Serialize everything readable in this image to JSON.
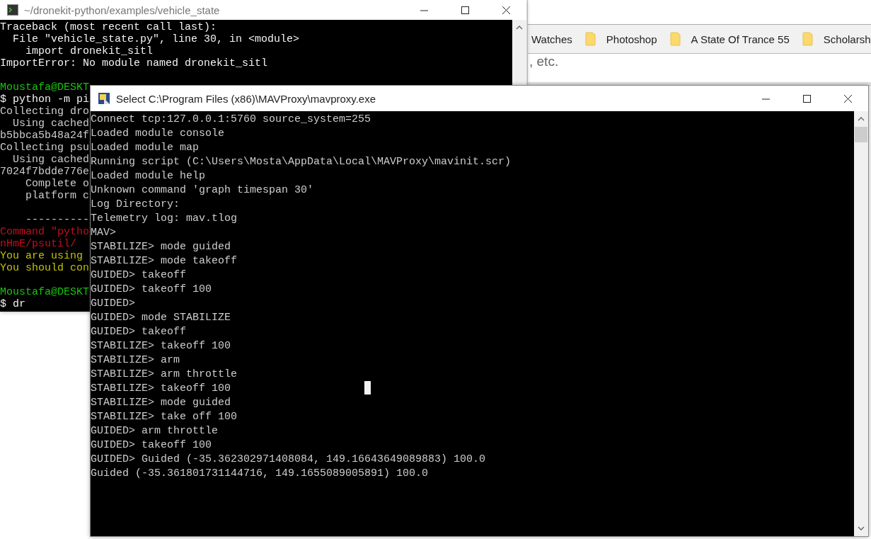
{
  "browser": {
    "bookmarks": [
      {
        "label": "Watches",
        "folder_icon": false
      },
      {
        "label": "Photoshop",
        "folder_icon": true
      },
      {
        "label": "A State Of Trance 55",
        "folder_icon": true
      },
      {
        "label": "Scholarsh",
        "folder_icon": true
      }
    ],
    "page_text": ", etc."
  },
  "back_terminal": {
    "title": "~/dronekit-python/examples/vehicle_state",
    "lines": [
      {
        "kind": "text",
        "text": "Traceback (most recent call last):",
        "color": "#f2f2f2"
      },
      {
        "kind": "text",
        "text": "  File \"vehicle_state.py\", line 30, in <module>",
        "color": "#f2f2f2"
      },
      {
        "kind": "text",
        "text": "    import dronekit_sitl",
        "color": "#f2f2f2"
      },
      {
        "kind": "text",
        "text": "ImportError: No module named dronekit_sitl",
        "color": "#f2f2f2"
      },
      {
        "kind": "blank"
      },
      {
        "kind": "text",
        "text": "Moustafa@DESKT",
        "color": "#16c60c"
      },
      {
        "kind": "text",
        "text": "$ python -m pi",
        "color": "#f2f2f2"
      },
      {
        "kind": "text",
        "text": "Collecting dro",
        "color": "#cccccc"
      },
      {
        "kind": "text",
        "text": "  Using cached",
        "color": "#cccccc"
      },
      {
        "kind": "text",
        "text": "b5bbca5b48a24f",
        "color": "#cccccc"
      },
      {
        "kind": "text",
        "text": "Collecting psu",
        "color": "#cccccc"
      },
      {
        "kind": "text",
        "text": "  Using cached",
        "color": "#cccccc"
      },
      {
        "kind": "text",
        "text": "7024f7bdde776e",
        "color": "#cccccc"
      },
      {
        "kind": "text",
        "text": "    Complete o",
        "color": "#cccccc"
      },
      {
        "kind": "text",
        "text": "    platform c",
        "color": "#cccccc"
      },
      {
        "kind": "blank"
      },
      {
        "kind": "text",
        "text": "    ----------",
        "color": "#cccccc"
      },
      {
        "kind": "text",
        "text": "Command \"pytho",
        "color": "#c50f1f"
      },
      {
        "kind": "text",
        "text": "nHmE/psutil/",
        "color": "#c50f1f"
      },
      {
        "kind": "text",
        "text": "You are using",
        "color": "#c1c100"
      },
      {
        "kind": "text",
        "text": "You should con",
        "color": "#c1c100"
      },
      {
        "kind": "blank"
      },
      {
        "kind": "text",
        "text": "Moustafa@DESKT",
        "color": "#16c60c"
      },
      {
        "kind": "text",
        "text": "$ dr",
        "color": "#f2f2f2"
      }
    ]
  },
  "front_terminal": {
    "title": "Select C:\\Program Files (x86)\\MAVProxy\\mavproxy.exe",
    "lines": [
      "Connect tcp:127.0.0.1:5760 source_system=255",
      "Loaded module console",
      "Loaded module map",
      "Running script (C:\\Users\\Mosta\\AppData\\Local\\MAVProxy\\mavinit.scr)",
      "Loaded module help",
      "Unknown command 'graph timespan 30'",
      "Log Directory:",
      "Telemetry log: mav.tlog",
      "MAV>",
      "STABILIZE> mode guided",
      "STABILIZE> mode takeoff",
      "GUIDED> takeoff",
      "GUIDED> takeoff 100",
      "GUIDED>",
      "GUIDED> mode STABILIZE",
      "GUIDED> takeoff",
      "STABILIZE> takeoff 100",
      "STABILIZE> arm",
      "STABILIZE> arm throttle",
      "STABILIZE> takeoff 100",
      "STABILIZE> mode guided",
      "STABILIZE> take off 100",
      "GUIDED> arm throttle",
      "GUIDED> takeoff 100",
      "GUIDED> Guided (-35.362302971408084, 149.16643649089883) 100.0",
      "Guided (-35.361801731144716, 149.1655089005891) 100.0"
    ]
  }
}
